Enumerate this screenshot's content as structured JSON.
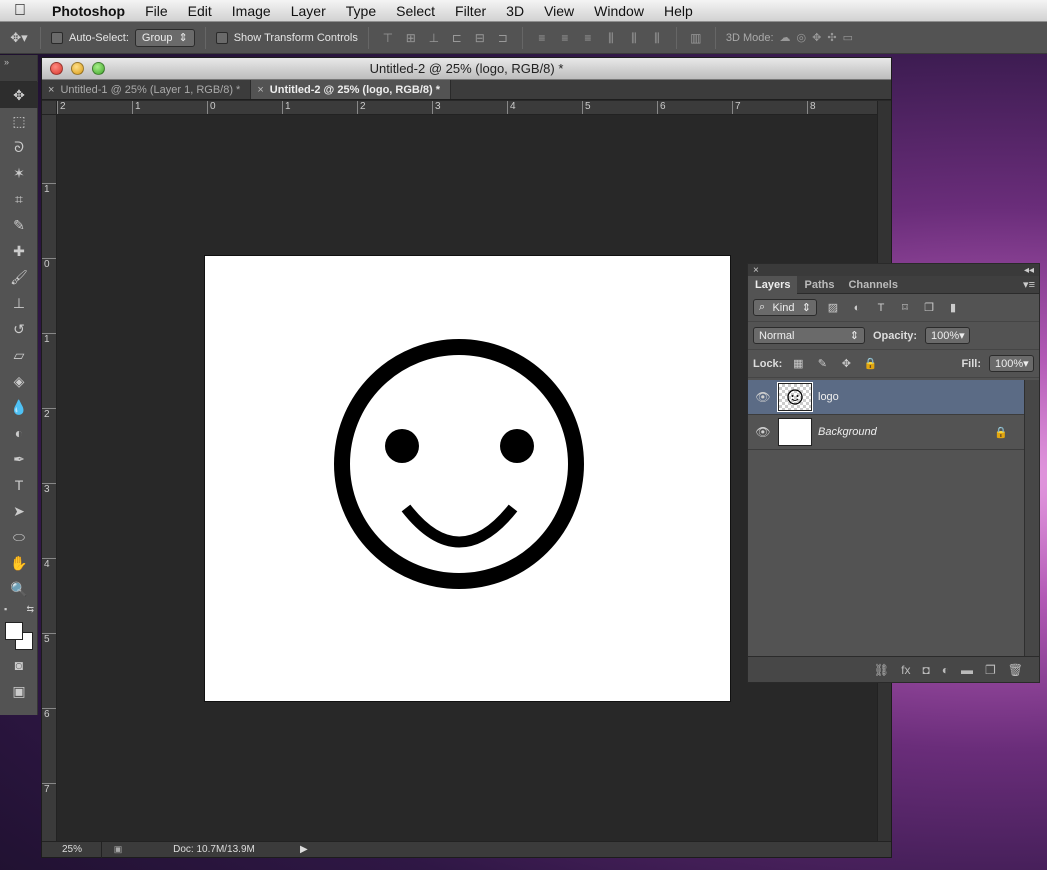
{
  "menubar": {
    "apple": "",
    "items": [
      "Photoshop",
      "File",
      "Edit",
      "Image",
      "Layer",
      "Type",
      "Select",
      "Filter",
      "3D",
      "View",
      "Window",
      "Help"
    ]
  },
  "options": {
    "auto_select_label": "Auto-Select:",
    "auto_select_value": "Group",
    "show_transform_label": "Show Transform Controls",
    "mode_3d_label": "3D Mode:"
  },
  "document": {
    "window_title": "Untitled-2 @ 25% (logo, RGB/8) *",
    "tabs": [
      {
        "label": "Untitled-1 @ 25% (Layer 1, RGB/8) *",
        "active": false
      },
      {
        "label": "Untitled-2 @ 25% (logo, RGB/8) *",
        "active": true
      }
    ],
    "ruler_h": [
      "2",
      "1",
      "0",
      "1",
      "2",
      "3",
      "4",
      "5",
      "6",
      "7",
      "8"
    ],
    "ruler_v": [
      "1",
      "0",
      "1",
      "2",
      "3",
      "4",
      "5",
      "6",
      "7"
    ],
    "zoom": "25%",
    "doc_size": "Doc: 10.7M/13.9M"
  },
  "layers_panel": {
    "tabs": [
      "Layers",
      "Paths",
      "Channels"
    ],
    "filter_label": "Kind",
    "blend_mode": "Normal",
    "opacity_label": "Opacity:",
    "opacity_value": "100%",
    "lock_label": "Lock:",
    "fill_label": "Fill:",
    "fill_value": "100%",
    "layers": [
      {
        "name": "logo",
        "selected": true
      },
      {
        "name": "Background",
        "selected": false
      }
    ]
  },
  "colors": {
    "accent_selected": "#5b6b85",
    "canvas": "#ffffff",
    "panel": "#535353"
  }
}
